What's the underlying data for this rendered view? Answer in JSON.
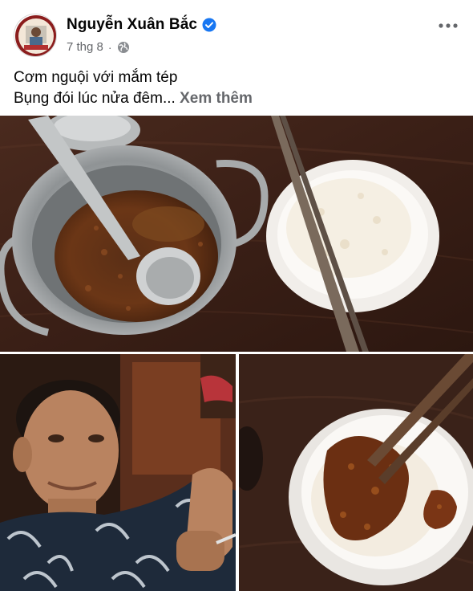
{
  "post": {
    "author": {
      "name": "Nguyễn Xuân Bắc",
      "verified": true,
      "avatar_icon": "avatar-photo"
    },
    "timestamp": "7 thg 8",
    "separator": "·",
    "privacy_icon": "globe-icon",
    "more_icon": "more-options-icon",
    "caption": {
      "line1": "Cơm nguội với mắm tép",
      "line2": "Bụng đói lúc nửa đêm...",
      "see_more": "Xem thêm"
    },
    "photos": [
      {
        "subject": "pot of shrimp paste with spoon, bowl of rice and chopsticks"
      },
      {
        "subject": "selfie of man in patterned shirt"
      },
      {
        "subject": "bowl of rice topped with shrimp paste and chopsticks"
      }
    ]
  },
  "colors": {
    "text_primary": "#050505",
    "text_secondary": "#65676b",
    "verified_blue": "#1877f2"
  }
}
